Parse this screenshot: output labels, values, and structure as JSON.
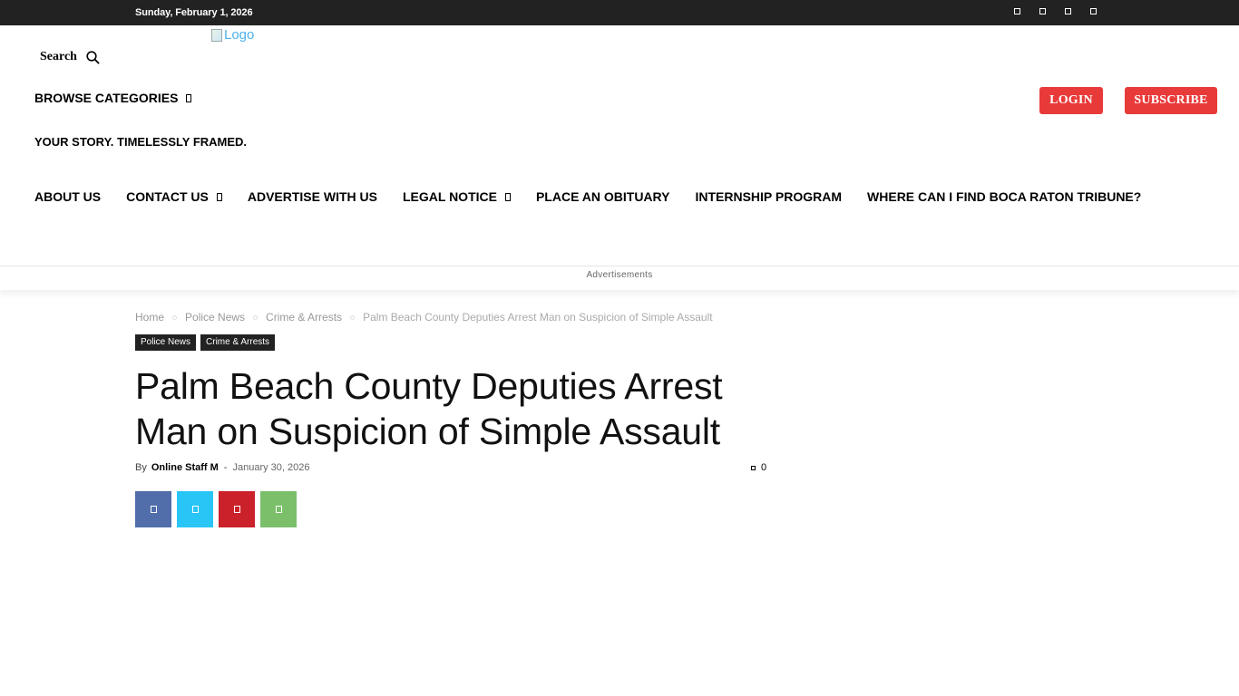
{
  "topbar": {
    "date": "Sunday, February 1, 2026",
    "social_icons": [
      "facebook-icon",
      "instagram-icon",
      "twitter-icon",
      "youtube-icon"
    ]
  },
  "header": {
    "search_label": "Search",
    "logo_alt": "Logo",
    "browse_label": "BROWSE CATEGORIES",
    "login_label": "LOGIN",
    "subscribe_label": "SUBSCRIBE",
    "tagline": "YOUR STORY. TIMELESSLY FRAMED.",
    "accent_color": "#e93a3a"
  },
  "nav": {
    "items": [
      {
        "label": "ABOUT US",
        "dropdown": false
      },
      {
        "label": "CONTACT US",
        "dropdown": true
      },
      {
        "label": "ADVERTISE WITH US",
        "dropdown": false
      },
      {
        "label": "LEGAL NOTICE",
        "dropdown": true
      },
      {
        "label": "PLACE AN OBITUARY",
        "dropdown": false
      },
      {
        "label": "INTERNSHIP PROGRAM",
        "dropdown": false
      },
      {
        "label": "WHERE CAN I FIND BOCA RATON TRIBUNE?",
        "dropdown": false
      }
    ]
  },
  "ads": {
    "label": "Advertisements"
  },
  "breadcrumb": {
    "items": [
      "Home",
      "Police News",
      "Crime & Arrests",
      "Palm Beach County Deputies Arrest Man on Suspicion of Simple Assault"
    ]
  },
  "article": {
    "tags": [
      "Police News",
      "Crime & Arrests"
    ],
    "title": "Palm Beach County Deputies Arrest Man on Suspicion of Simple Assault",
    "by_label": "By",
    "author": "Online Staff M",
    "separator": "-",
    "date": "January 30, 2026",
    "comment_count": "0"
  },
  "share": {
    "buttons": [
      {
        "icon": "facebook-icon",
        "color": "#516eab"
      },
      {
        "icon": "twitter-icon",
        "color": "#29c5f6"
      },
      {
        "icon": "pinterest-icon",
        "color": "#ca212a"
      },
      {
        "icon": "whatsapp-icon",
        "color": "#7bbf6a"
      }
    ]
  }
}
